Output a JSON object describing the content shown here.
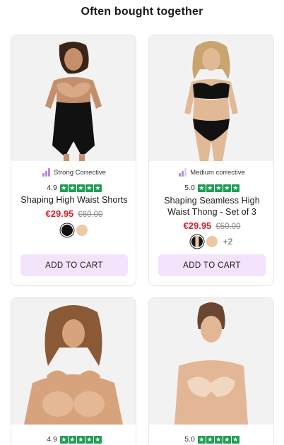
{
  "section": {
    "title": "Often bought together"
  },
  "products": [
    {
      "badge": "Strong Corrective",
      "rating": "4.9",
      "name": "Shaping High Waist Shorts",
      "price": "€29.95",
      "old_price": "€60.00",
      "swatches": [
        "#111111",
        "#ecc9a3"
      ],
      "more": "",
      "cart_label": "ADD TO CART"
    },
    {
      "badge": "Medium corrective",
      "rating": "5.0",
      "name": "Shaping Seamless High Waist Thong - Set of 3",
      "price": "€29.95",
      "old_price": "€50.00",
      "swatches": [
        "#111111",
        "#ecc9a3"
      ],
      "more": "+2",
      "cart_label": "ADD TO CART"
    },
    {
      "rating": "4.9"
    },
    {
      "rating": "5.0"
    }
  ],
  "colors": {
    "accent_price": "#d2222d",
    "star": "#1f9d55",
    "cart_bg": "#f3e3fb",
    "badge_bars": "#b58ad8"
  }
}
